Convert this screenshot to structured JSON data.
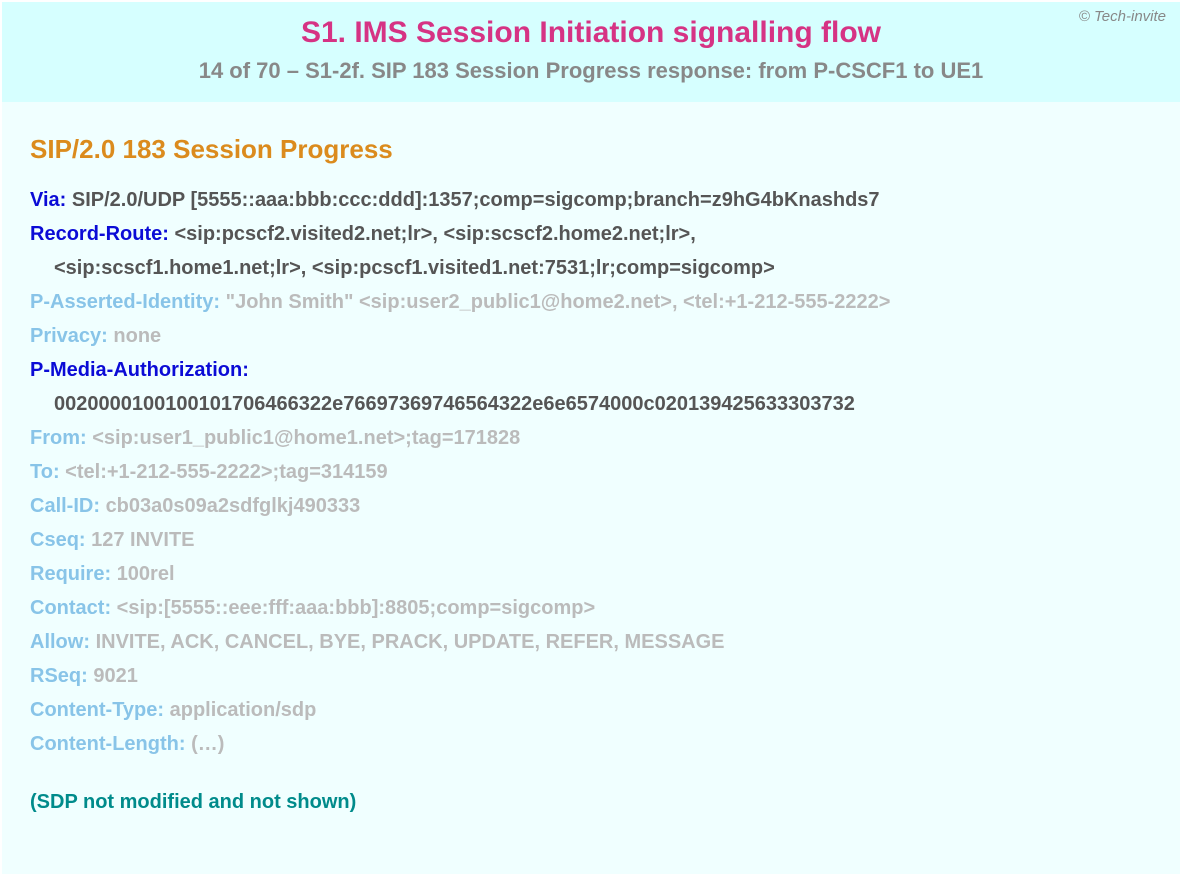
{
  "copyright": "© Tech-invite",
  "header": {
    "title": "S1. IMS Session Initiation signalling flow",
    "subtitle": "14 of 70 – S1-2f. SIP 183 Session Progress response: from P-CSCF1 to UE1"
  },
  "status_line": "SIP/2.0 183 Session Progress",
  "headers": {
    "via": {
      "name": "Via",
      "value": "SIP/2.0/UDP [5555::aaa:bbb:ccc:ddd]:1357;comp=sigcomp;branch=z9hG4bKnashds7"
    },
    "record_route": {
      "name": "Record-Route",
      "value_line1": "<sip:pcscf2.visited2.net;lr>, <sip:scscf2.home2.net;lr>,",
      "value_line2": "<sip:scscf1.home1.net;lr>, <sip:pcscf1.visited1.net:7531;lr;comp=sigcomp>"
    },
    "p_asserted_identity": {
      "name": "P-Asserted-Identity",
      "value": "\"John Smith\" <sip:user2_public1@home2.net>, <tel:+1-212-555-2222>"
    },
    "privacy": {
      "name": "Privacy",
      "value": "none"
    },
    "p_media_authorization": {
      "name": "P-Media-Authorization",
      "value": "0020000100100101706466322e76697369746564322e6e6574000c020139425633303732"
    },
    "from": {
      "name": "From",
      "value": "<sip:user1_public1@home1.net>;tag=171828"
    },
    "to": {
      "name": "To",
      "value": "<tel:+1-212-555-2222>;tag=314159"
    },
    "call_id": {
      "name": "Call-ID",
      "value": "cb03a0s09a2sdfglkj490333"
    },
    "cseq": {
      "name": "Cseq",
      "value": "127 INVITE"
    },
    "require": {
      "name": "Require",
      "value": "100rel"
    },
    "contact": {
      "name": "Contact",
      "value": "<sip:[5555::eee:fff:aaa:bbb]:8805;comp=sigcomp>"
    },
    "allow": {
      "name": "Allow",
      "value": "INVITE, ACK, CANCEL, BYE, PRACK, UPDATE, REFER, MESSAGE"
    },
    "rseq": {
      "name": "RSeq",
      "value": "9021"
    },
    "content_type": {
      "name": "Content-Type",
      "value": "application/sdp"
    },
    "content_length": {
      "name": "Content-Length",
      "value": "(…)"
    }
  },
  "sdp_note": "(SDP not modified and not shown)"
}
